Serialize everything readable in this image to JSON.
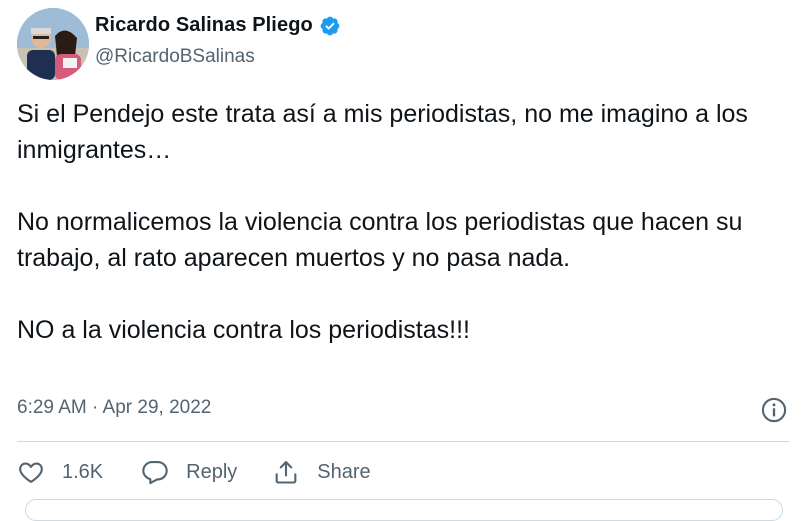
{
  "author": {
    "display_name": "Ricardo Salinas Pliego",
    "handle": "@RicardoBSalinas",
    "verified": true
  },
  "tweet": {
    "paragraphs": [
      "Si el Pendejo este trata así a mis periodistas, no me imagino a los inmigrantes…",
      "No normalicemos la violencia contra los periodistas que hacen su trabajo, al rato aparecen muertos y no pasa nada.",
      "NO a la violencia contra los periodistas!!!"
    ],
    "timestamp": "6:29 AM · Apr 29, 2022"
  },
  "actions": {
    "like_count": "1.6K",
    "reply_label": "Reply",
    "share_label": "Share"
  },
  "icons": {
    "verified": "verified-badge-icon",
    "info": "info-icon",
    "like": "heart-icon",
    "reply": "speech-bubble-icon",
    "share": "share-upload-icon"
  },
  "colors": {
    "text": "#0f1419",
    "secondary": "#536471",
    "verified_blue": "#1d9bf0",
    "divider": "#cfd9de"
  }
}
